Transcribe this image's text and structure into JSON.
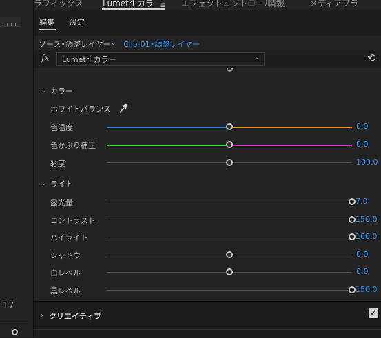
{
  "tabs": [
    {
      "label": "ラフィックス"
    },
    {
      "label": "Lumetri カラー",
      "active": true
    },
    {
      "label": "エフェクトコントロール"
    },
    {
      "label": "情報"
    },
    {
      "label": "メディアブラ"
    }
  ],
  "subtabs": [
    {
      "label": "編集",
      "active": true
    },
    {
      "label": "設定"
    }
  ],
  "source": {
    "label": "ソース•調整レイヤー",
    "clip": "Clip-01•調整レイヤー"
  },
  "effect": {
    "fx": "fx",
    "name": "Lumetri カラー"
  },
  "left_panel": {
    "number": "17"
  },
  "color_section": {
    "title": "カラー",
    "white_balance": "ホワイトバランス",
    "rows": [
      {
        "label": "色温度",
        "value": "0.0",
        "fraction": 0.5,
        "gradient": "temp"
      },
      {
        "label": "色かぶり補正",
        "value": "0.0",
        "fraction": 0.5,
        "gradient": "tint"
      },
      {
        "label": "彩度",
        "value": "100.0",
        "fraction": 0.5
      }
    ]
  },
  "light_section": {
    "title": "ライト",
    "rows": [
      {
        "label": "露光量",
        "value": "7.0",
        "fraction": 1.0
      },
      {
        "label": "コントラスト",
        "value": "150.0",
        "fraction": 1.0
      },
      {
        "label": "ハイライト",
        "value": "100.0",
        "fraction": 1.0
      },
      {
        "label": "シャドウ",
        "value": "0.0",
        "fraction": 0.5
      },
      {
        "label": "白レベル",
        "value": "0.0",
        "fraction": 0.5
      },
      {
        "label": "黒レベル",
        "value": "150.0",
        "fraction": 1.0
      }
    ]
  },
  "creative": {
    "label": "クリエイティブ",
    "checked": true
  },
  "colors": {
    "accent": "#2d8ceb",
    "temp_left": "#2f7fd6",
    "temp_right": "#e08a2a",
    "tint_left": "#3ad63a",
    "tint_right": "#c93fc9"
  }
}
